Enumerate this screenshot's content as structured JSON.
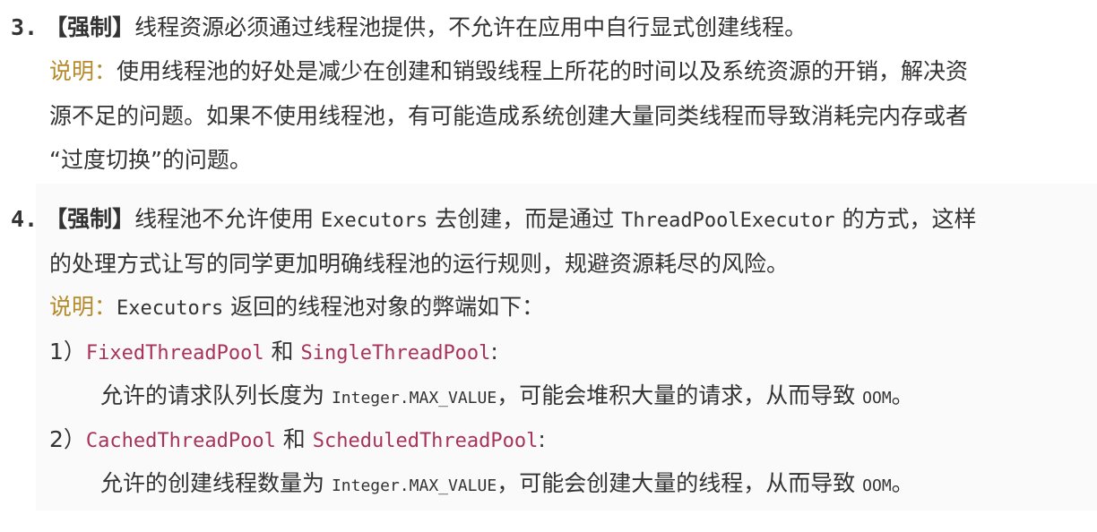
{
  "rule3": {
    "number": "3.",
    "tag": "【强制】",
    "text": "线程资源必须通过线程池提供，不允许在应用中自行显式创建线程。",
    "note_label": "说明：",
    "note_line1": "使用线程池的好处是减少在创建和销毁线程上所花的时间以及系统资源的开销，解决资",
    "note_line2": "源不足的问题。如果不使用线程池，有可能造成系统创建大量同类线程而导致消耗完内存或者",
    "note_line3": "“过度切换”的问题。"
  },
  "rule4": {
    "number": "4.",
    "tag": "【强制】",
    "text_a": "线程池不允许使用 ",
    "code_a": "Executors",
    "text_b": " 去创建，而是通过 ",
    "code_b": "ThreadPoolExecutor",
    "text_c": " 的方式，这样",
    "line2": "的处理方式让写的同学更加明确线程池的运行规则，规避资源耗尽的风险。",
    "note_label": "说明：",
    "note_code": "Executors",
    "note_text": " 返回的线程池对象的弊端如下：",
    "items": [
      {
        "index": "1）",
        "code_a": "FixedThreadPool",
        "join": " 和 ",
        "code_b": "SingleThreadPool",
        "colon": ":",
        "desc_a": "允许的请求队列长度为 ",
        "desc_code": "Integer.MAX_VALUE",
        "desc_b": "，可能会堆积大量的请求，从而导致 ",
        "desc_oom": "OOM",
        "desc_end": "。"
      },
      {
        "index": "2）",
        "code_a": "CachedThreadPool",
        "join": " 和 ",
        "code_b": "ScheduledThreadPool",
        "colon": ":",
        "desc_a": "允许的创建线程数量为 ",
        "desc_code": "Integer.MAX_VALUE",
        "desc_b": "，可能会创建大量的线程，从而导致 ",
        "desc_oom": "OOM",
        "desc_end": "。"
      }
    ]
  }
}
